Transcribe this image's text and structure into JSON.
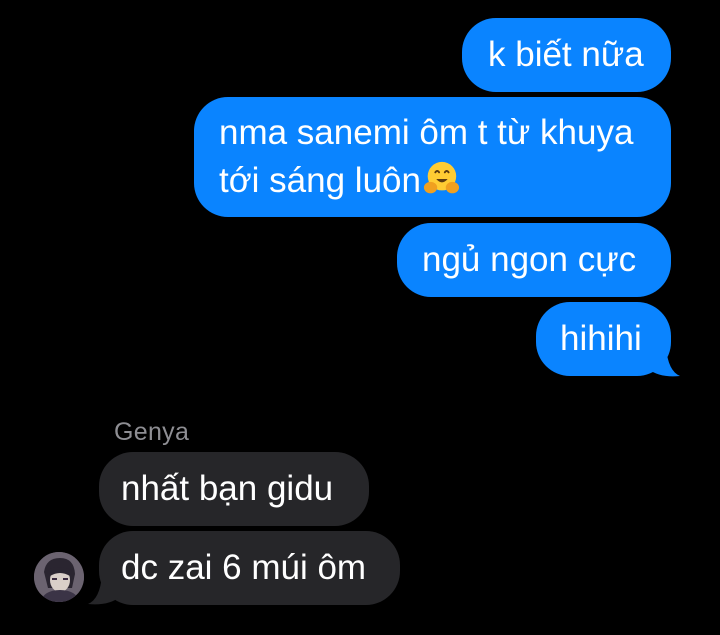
{
  "conversation": {
    "outgoing": [
      {
        "text": "k biết nữa"
      },
      {
        "line1": "nma sanemi ôm t từ khuya",
        "line2": "tới sáng luôn",
        "emoji": "hugging-face-emoji"
      },
      {
        "text": "ngủ ngon cực"
      },
      {
        "text": "hihihi"
      }
    ],
    "sender_name": "Genya",
    "incoming": [
      {
        "text": "nhất bạn gidu"
      },
      {
        "text": "dc zai 6 múi ôm"
      }
    ]
  },
  "colors": {
    "background": "#000000",
    "outgoing_bubble": "#0a84ff",
    "incoming_bubble": "#262629",
    "sender_name": "#8e8e93"
  }
}
